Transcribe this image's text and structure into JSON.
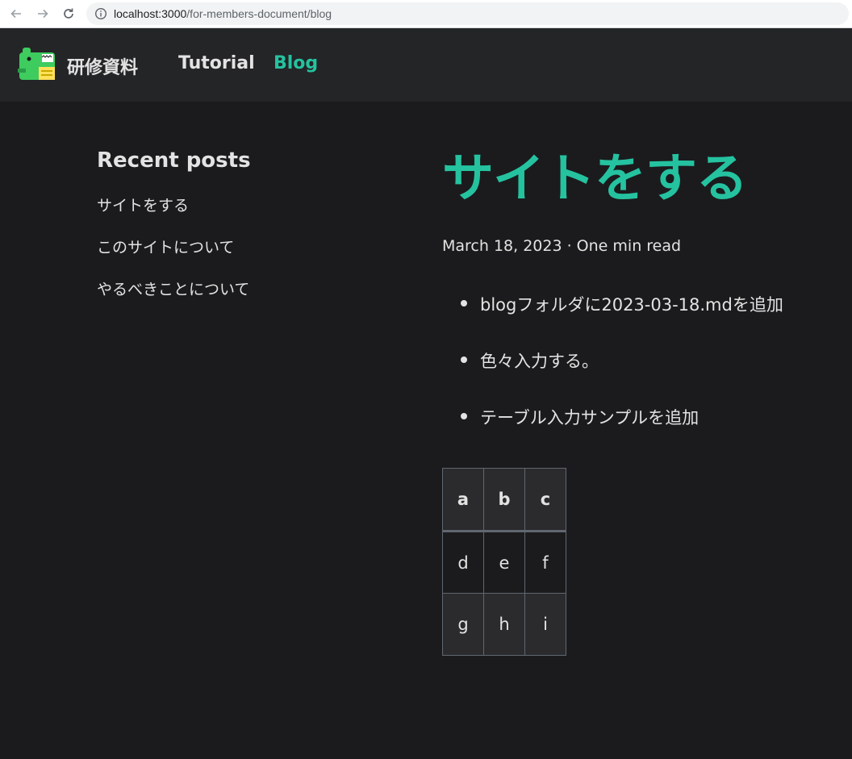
{
  "browser": {
    "url_host": "localhost:3000",
    "url_path": "/for-members-document/blog"
  },
  "navbar": {
    "brand": "研修資料",
    "links": [
      "Tutorial",
      "Blog"
    ],
    "active": "Blog"
  },
  "sidebar": {
    "title": "Recent posts",
    "items": [
      "サイトをする",
      "このサイトについて",
      "やるべきことについて"
    ]
  },
  "post": {
    "title": "サイトをする",
    "meta": "March 18, 2023 · One min read",
    "bullets": [
      "blogフォルダに2023-03-18.mdを追加",
      "色々入力する。",
      "テーブル入力サンプルを追加"
    ],
    "table": {
      "headers": [
        "a",
        "b",
        "c"
      ],
      "rows": [
        [
          "d",
          "e",
          "f"
        ],
        [
          "g",
          "h",
          "i"
        ]
      ]
    }
  },
  "colors": {
    "accent": "#25c2a0",
    "background": "#1b1b1d",
    "navbar": "#242526"
  }
}
